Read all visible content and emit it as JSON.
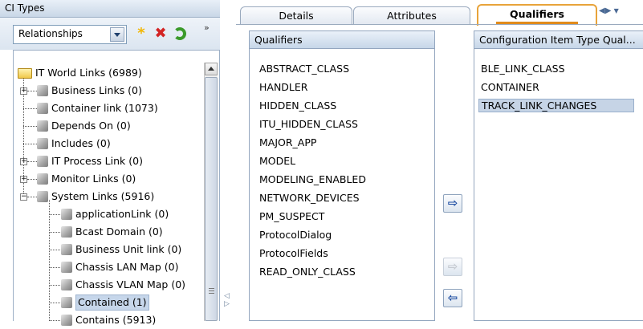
{
  "left_panel": {
    "title": "CI Types",
    "type_selector": {
      "value": "Relationships"
    },
    "toolbar": {
      "new_icon": "*",
      "delete_icon": "✖",
      "more_icon": "»"
    },
    "tree": {
      "root": "IT World Links (6989)",
      "items": [
        "Business Links (0)",
        "Container link (1073)",
        "Depends On (0)",
        "Includes (0)",
        "IT Process Link (0)",
        "Monitor Links (0)",
        "System Links (5916)"
      ],
      "children": [
        "applicationLink (0)",
        "Bcast Domain (0)",
        "Business Unit link (0)",
        "Chassis LAN Map (0)",
        "Chassis VLAN Map (0)",
        "Contained (1)",
        "Contains (5913)"
      ],
      "selected": "Contained (1)"
    }
  },
  "tabs": {
    "details": "Details",
    "attributes": "Attributes",
    "qualifiers": "Qualifiers",
    "active": "Qualifiers"
  },
  "qualifiers": {
    "available_header": "Qualifiers",
    "available": [
      "ABSTRACT_CLASS",
      "HANDLER",
      "HIDDEN_CLASS",
      "ITU_HIDDEN_CLASS",
      "MAJOR_APP",
      "MODEL",
      "MODELING_ENABLED",
      "NETWORK_DEVICES",
      "PM_SUSPECT",
      "ProtocolDialog",
      "ProtocolFields",
      "READ_ONLY_CLASS"
    ],
    "selected_header": "Configuration Item Type Qual...",
    "selected_list": [
      "BLE_LINK_CLASS",
      "CONTAINER",
      "TRACK_LINK_CHANGES"
    ],
    "selected_item": "TRACK_LINK_CHANGES",
    "buttons": {
      "add": "⇨",
      "add_all": "⇨",
      "remove": "⇦"
    }
  },
  "colors": {
    "active_tab_accent": "#e18b1b",
    "selection": "#c6d4e6",
    "header_gradient_top": "#eaf1f9"
  }
}
